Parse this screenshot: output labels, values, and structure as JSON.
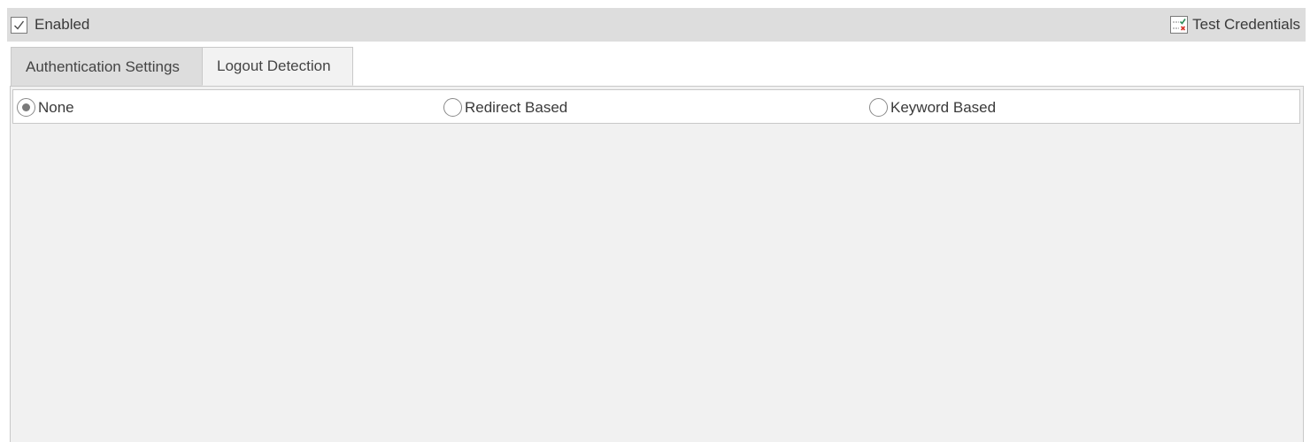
{
  "toolbar": {
    "enabled_label": "Enabled",
    "enabled_checked": true,
    "test_credentials_label": "Test Credentials",
    "test_credentials_icon": "test-credentials-icon"
  },
  "tabs": [
    {
      "label": "Authentication Settings",
      "active": false
    },
    {
      "label": "Logout Detection",
      "active": true
    }
  ],
  "logout_detection": {
    "options": [
      {
        "label": "None",
        "selected": true
      },
      {
        "label": "Redirect Based",
        "selected": false
      },
      {
        "label": "Keyword Based",
        "selected": false
      }
    ]
  },
  "colors": {
    "toolbar_bg": "#dddddd",
    "panel_bg": "#f1f1f1",
    "border": "#c8c8c8",
    "icon_check_green": "#2e8b57",
    "icon_x_red": "#d9342b"
  }
}
